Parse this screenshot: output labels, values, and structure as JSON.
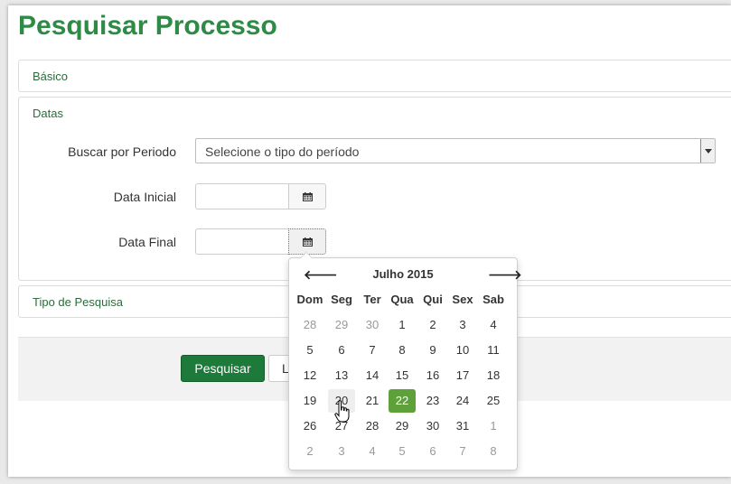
{
  "page": {
    "title": "Pesquisar Processo"
  },
  "sections": {
    "basico": "Básico",
    "datas": "Datas",
    "tipo": "Tipo de Pesquisa"
  },
  "form": {
    "periodo_label": "Buscar por Periodo",
    "periodo_value": "Selecione o tipo do período",
    "data_inicial_label": "Data Inicial",
    "data_final_label": "Data Final"
  },
  "buttons": {
    "pesquisar": "Pesquisar",
    "limpar": "L"
  },
  "datepicker": {
    "prev": "🡐",
    "next": "🡒",
    "month_year": "Julho 2015",
    "weekdays": [
      "Dom",
      "Seg",
      "Ter",
      "Qua",
      "Qui",
      "Sex",
      "Sab"
    ],
    "weeks": [
      [
        "28",
        "29",
        "30",
        "1",
        "2",
        "3",
        "4"
      ],
      [
        "5",
        "6",
        "7",
        "8",
        "9",
        "10",
        "11"
      ],
      [
        "12",
        "13",
        "14",
        "15",
        "16",
        "17",
        "18"
      ],
      [
        "19",
        "20",
        "21",
        "22",
        "23",
        "24",
        "25"
      ],
      [
        "26",
        "27",
        "28",
        "29",
        "30",
        "31",
        "1"
      ],
      [
        "2",
        "3",
        "4",
        "5",
        "6",
        "7",
        "8"
      ]
    ],
    "selected_day": "22",
    "hover_day": "20",
    "colors": {
      "selected": "#5ea039",
      "brand": "#2e8b46"
    }
  }
}
